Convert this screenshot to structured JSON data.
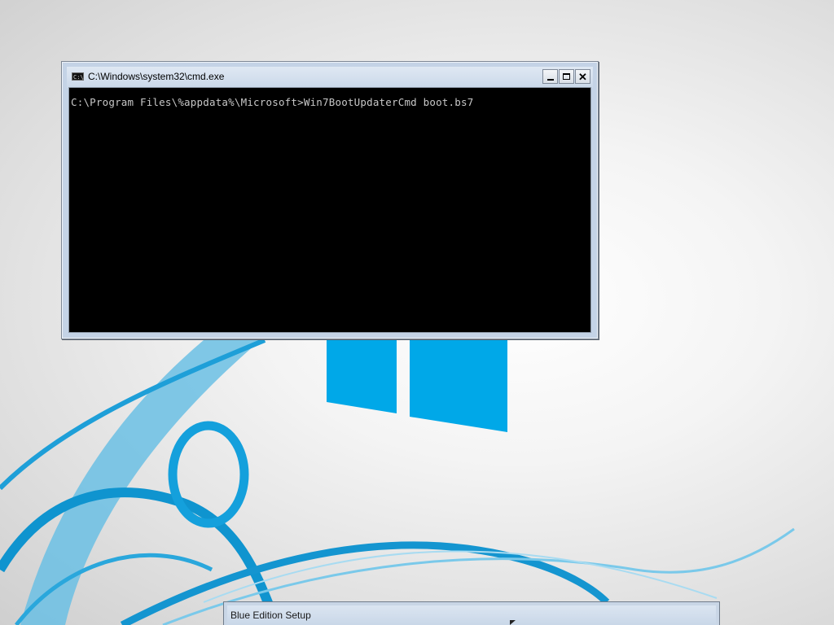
{
  "desktop": {
    "colors": {
      "accent": "#00a8e8",
      "swirl": "#1d9cd6",
      "background": "#efefef"
    }
  },
  "cmd_window": {
    "title": "C:\\Windows\\system32\\cmd.exe",
    "icon_text": "C:\\",
    "minimize_icon": "minimize-icon",
    "maximize_icon": "maximize-icon",
    "close_label": "✕",
    "console_line": "C:\\Program Files\\%appdata%\\Microsoft>Win7BootUpdaterCmd boot.bs7",
    "colors": {
      "console_bg": "#000000",
      "console_text": "#c8c8c8"
    }
  },
  "setup_window": {
    "title": "Blue Edition Setup"
  }
}
